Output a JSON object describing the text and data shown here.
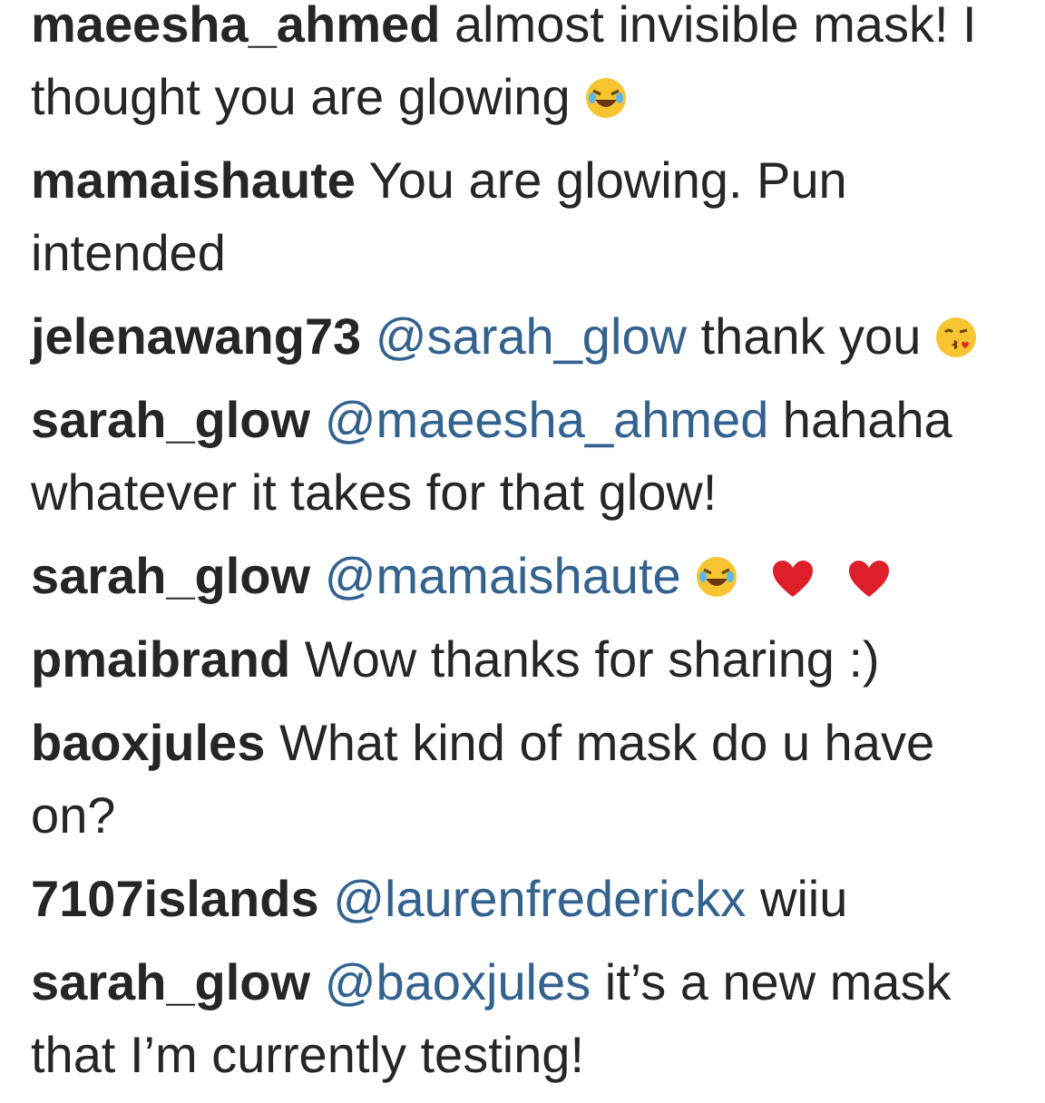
{
  "comments": [
    {
      "username": "maeesha_ahmed",
      "text": "almost invisible mask! I\nthought you are glowing",
      "emojis": [
        {
          "kind": "laughing"
        }
      ]
    },
    {
      "username": "mamaishaute",
      "text": "You are glowing. Pun\nintended"
    },
    {
      "username": "jelenawang73",
      "mention": "@sarah_glow",
      "text": "thank you",
      "emojis": [
        {
          "kind": "kissing"
        }
      ]
    },
    {
      "username": "sarah_glow",
      "mention": "@maeesha_ahmed",
      "text": "hahaha\nwhatever it takes for that glow!"
    },
    {
      "username": "sarah_glow",
      "mention": "@mamaishaute",
      "emojis": [
        {
          "kind": "laughing"
        },
        {
          "kind": "heart"
        },
        {
          "kind": "heart"
        }
      ]
    },
    {
      "username": "pmaibrand",
      "text": "Wow thanks for sharing :)"
    },
    {
      "username": "baoxjules",
      "text": "What kind of mask do u have\non?"
    },
    {
      "username": "7107islands",
      "mention": "@laurenfrederickx",
      "text": "wiiu"
    },
    {
      "username": "sarah_glow",
      "mention": "@baoxjules",
      "text": "it’s a new mask\nthat I’m currently testing!"
    }
  ]
}
